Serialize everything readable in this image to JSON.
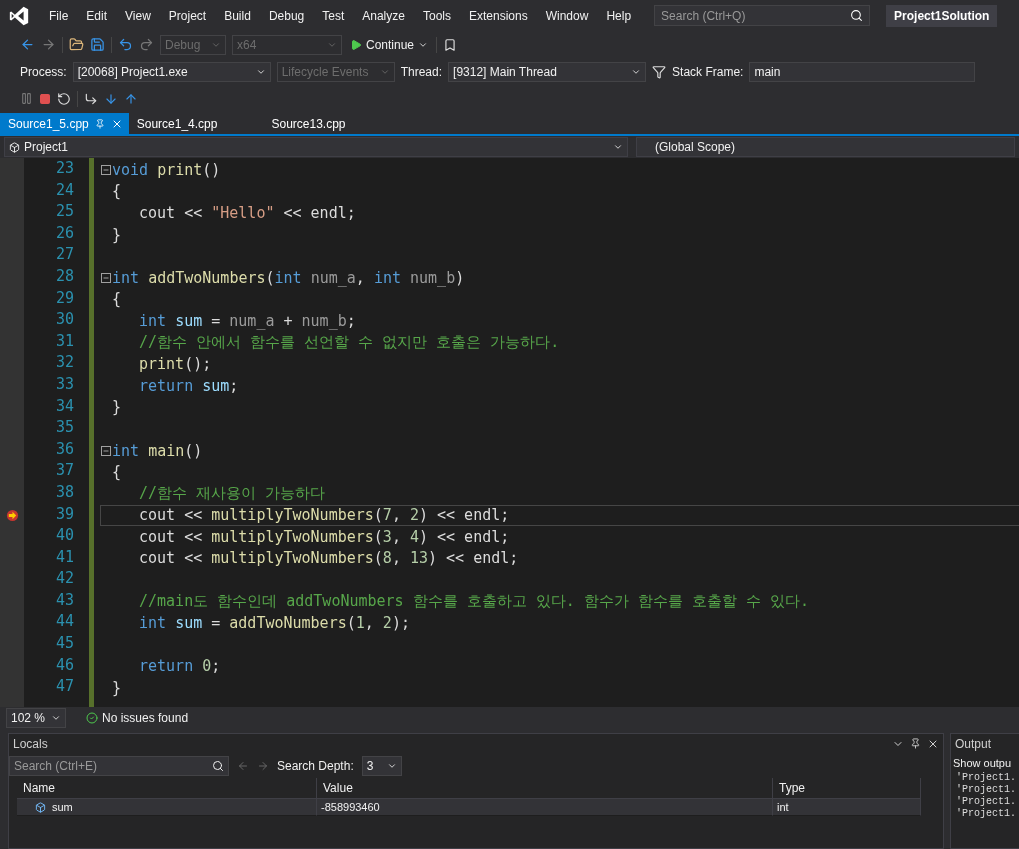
{
  "menu": [
    "File",
    "Edit",
    "View",
    "Project",
    "Build",
    "Debug",
    "Test",
    "Analyze",
    "Tools",
    "Extensions",
    "Window",
    "Help"
  ],
  "search": {
    "placeholder": "Search (Ctrl+Q)"
  },
  "solution": "Project1Solution",
  "toolbar": {
    "configuration": "Debug",
    "platform": "x64",
    "continue": "Continue"
  },
  "debug_bar": {
    "process_label": "Process:",
    "process": "[20068] Project1.exe",
    "lifecycle": "Lifecycle Events",
    "thread_label": "Thread:",
    "thread": "[9312] Main Thread",
    "frame_label": "Stack Frame:",
    "frame": "main"
  },
  "tabs": [
    {
      "label": "Source1_5.cpp",
      "selected": true
    },
    {
      "label": "Source1_4.cpp",
      "selected": false
    },
    {
      "label": "Source13.cpp",
      "selected": false
    }
  ],
  "nav": {
    "project": "Project1",
    "scope": "(Global Scope)"
  },
  "code": [
    {
      "n": "23",
      "fold": true,
      "indent": false,
      "current": false,
      "tokens": [
        {
          "t": "void ",
          "color": "#569cd6"
        },
        {
          "t": "print",
          "color": "#dcdcaa"
        },
        {
          "t": "()",
          "color": "#dcdcdc"
        }
      ]
    },
    {
      "n": "24",
      "fold": false,
      "indent": false,
      "current": false,
      "tokens": [
        {
          "t": "{",
          "color": "#dcdcdc"
        }
      ]
    },
    {
      "n": "25",
      "fold": false,
      "indent": true,
      "current": false,
      "tokens": [
        {
          "t": "cout << ",
          "color": "#dcdcdc"
        },
        {
          "t": "\"Hello\"",
          "color": "#d69d85"
        },
        {
          "t": " << endl;",
          "color": "#dcdcdc"
        }
      ]
    },
    {
      "n": "26",
      "fold": false,
      "indent": false,
      "current": false,
      "tokens": [
        {
          "t": "}",
          "color": "#dcdcdc"
        }
      ]
    },
    {
      "n": "27",
      "fold": false,
      "current": false
    },
    {
      "n": "28",
      "fold": true,
      "indent": false,
      "current": false,
      "tokens": [
        {
          "t": "int ",
          "color": "#569cd6"
        },
        {
          "t": "addTwoNumbers",
          "color": "#dcdcaa"
        },
        {
          "t": "(",
          "color": "#dcdcdc"
        },
        {
          "t": "int ",
          "color": "#569cd6"
        },
        {
          "t": "num_a",
          "color": "#9a9a9a"
        },
        {
          "t": ", ",
          "color": "#dcdcdc"
        },
        {
          "t": "int ",
          "color": "#569cd6"
        },
        {
          "t": "num_b",
          "color": "#9a9a9a"
        },
        {
          "t": ")",
          "color": "#dcdcdc"
        }
      ]
    },
    {
      "n": "29",
      "fold": false,
      "indent": false,
      "current": false,
      "tokens": [
        {
          "t": "{",
          "color": "#dcdcdc"
        }
      ]
    },
    {
      "n": "30",
      "fold": false,
      "indent": true,
      "current": false,
      "tokens": [
        {
          "t": "int ",
          "color": "#569cd6"
        },
        {
          "t": "sum",
          "color": "#9cdcfe"
        },
        {
          "t": " = ",
          "color": "#dcdcdc"
        },
        {
          "t": "num_a",
          "color": "#9a9a9a"
        },
        {
          "t": " + ",
          "color": "#dcdcdc"
        },
        {
          "t": "num_b",
          "color": "#9a9a9a"
        },
        {
          "t": ";",
          "color": "#dcdcdc"
        }
      ]
    },
    {
      "n": "31",
      "fold": false,
      "indent": true,
      "current": false,
      "tokens": [
        {
          "t": "//함수 안에서 함수를 선언할 수 없지만 호출은 가능하다.",
          "color": "#57a64a"
        }
      ]
    },
    {
      "n": "32",
      "fold": false,
      "indent": true,
      "current": false,
      "tokens": [
        {
          "t": "print",
          "color": "#dcdcaa"
        },
        {
          "t": "();",
          "color": "#dcdcdc"
        }
      ]
    },
    {
      "n": "33",
      "fold": false,
      "indent": true,
      "current": false,
      "tokens": [
        {
          "t": "return ",
          "color": "#569cd6"
        },
        {
          "t": "sum",
          "color": "#9cdcfe"
        },
        {
          "t": ";",
          "color": "#dcdcdc"
        }
      ]
    },
    {
      "n": "34",
      "fold": false,
      "indent": false,
      "current": false,
      "tokens": [
        {
          "t": "}",
          "color": "#dcdcdc"
        }
      ]
    },
    {
      "n": "35",
      "fold": false,
      "current": false
    },
    {
      "n": "36",
      "fold": true,
      "indent": false,
      "current": false,
      "tokens": [
        {
          "t": "int ",
          "color": "#569cd6"
        },
        {
          "t": "main",
          "color": "#dcdcaa"
        },
        {
          "t": "()",
          "color": "#dcdcdc"
        }
      ]
    },
    {
      "n": "37",
      "fold": false,
      "indent": false,
      "current": false,
      "tokens": [
        {
          "t": "{",
          "color": "#dcdcdc"
        }
      ]
    },
    {
      "n": "38",
      "fold": false,
      "indent": true,
      "current": false,
      "tokens": [
        {
          "t": "//함수 재사용이 가능하다",
          "color": "#57a64a"
        }
      ]
    },
    {
      "n": "39",
      "fold": false,
      "indent": true,
      "current": true,
      "tokens": [
        {
          "t": "cout << ",
          "color": "#dcdcdc"
        },
        {
          "t": "multiplyTwoNumbers",
          "color": "#dcdcaa"
        },
        {
          "t": "(",
          "color": "#dcdcdc"
        },
        {
          "t": "7",
          "color": "#b5cea8"
        },
        {
          "t": ", ",
          "color": "#dcdcdc"
        },
        {
          "t": "2",
          "color": "#b5cea8"
        },
        {
          "t": ") << endl;",
          "color": "#dcdcdc"
        }
      ]
    },
    {
      "n": "40",
      "fold": false,
      "indent": true,
      "current": false,
      "tokens": [
        {
          "t": "cout << ",
          "color": "#dcdcdc"
        },
        {
          "t": "multiplyTwoNumbers",
          "color": "#dcdcaa"
        },
        {
          "t": "(",
          "color": "#dcdcdc"
        },
        {
          "t": "3",
          "color": "#b5cea8"
        },
        {
          "t": ", ",
          "color": "#dcdcdc"
        },
        {
          "t": "4",
          "color": "#b5cea8"
        },
        {
          "t": ") << endl;",
          "color": "#dcdcdc"
        }
      ]
    },
    {
      "n": "41",
      "fold": false,
      "indent": true,
      "current": false,
      "tokens": [
        {
          "t": "cout << ",
          "color": "#dcdcdc"
        },
        {
          "t": "multiplyTwoNumbers",
          "color": "#dcdcaa"
        },
        {
          "t": "(",
          "color": "#dcdcdc"
        },
        {
          "t": "8",
          "color": "#b5cea8"
        },
        {
          "t": ", ",
          "color": "#dcdcdc"
        },
        {
          "t": "13",
          "color": "#b5cea8"
        },
        {
          "t": ") << endl;",
          "color": "#dcdcdc"
        }
      ]
    },
    {
      "n": "42",
      "fold": false,
      "current": false
    },
    {
      "n": "43",
      "fold": false,
      "indent": true,
      "current": false,
      "tokens": [
        {
          "t": "//main도 함수인데 addTwoNumbers 함수를 호출하고 있다. 함수가 함수를 호출할 수 있다.",
          "color": "#57a64a"
        }
      ]
    },
    {
      "n": "44",
      "fold": false,
      "indent": true,
      "current": false,
      "tokens": [
        {
          "t": "int ",
          "color": "#569cd6"
        },
        {
          "t": "sum",
          "color": "#9cdcfe"
        },
        {
          "t": " = ",
          "color": "#dcdcdc"
        },
        {
          "t": "addTwoNumbers",
          "color": "#dcdcaa"
        },
        {
          "t": "(",
          "color": "#dcdcdc"
        },
        {
          "t": "1",
          "color": "#b5cea8"
        },
        {
          "t": ", ",
          "color": "#dcdcdc"
        },
        {
          "t": "2",
          "color": "#b5cea8"
        },
        {
          "t": ");",
          "color": "#dcdcdc"
        }
      ]
    },
    {
      "n": "45",
      "fold": false,
      "current": false
    },
    {
      "n": "46",
      "fold": false,
      "indent": true,
      "current": false,
      "tokens": [
        {
          "t": "return ",
          "color": "#569cd6"
        },
        {
          "t": "0",
          "color": "#b5cea8"
        },
        {
          "t": ";",
          "color": "#dcdcdc"
        }
      ]
    },
    {
      "n": "47",
      "fold": false,
      "indent": false,
      "current": false,
      "tokens": [
        {
          "t": "}",
          "color": "#dcdcdc"
        }
      ]
    }
  ],
  "editor_status": {
    "zoom": "102 %",
    "issues": "No issues found"
  },
  "locals": {
    "title": "Locals",
    "search_placeholder": "Search (Ctrl+E)",
    "depth_label": "Search Depth:",
    "depth": "3",
    "columns": [
      "Name",
      "Value",
      "Type"
    ],
    "rows": [
      {
        "name": "sum",
        "value": "-858993460",
        "type": "int"
      }
    ]
  },
  "output": {
    "title": "Output",
    "show": "Show outpu",
    "lines": [
      "'Project1.",
      "'Project1.",
      "'Project1.",
      "'Project1."
    ]
  }
}
